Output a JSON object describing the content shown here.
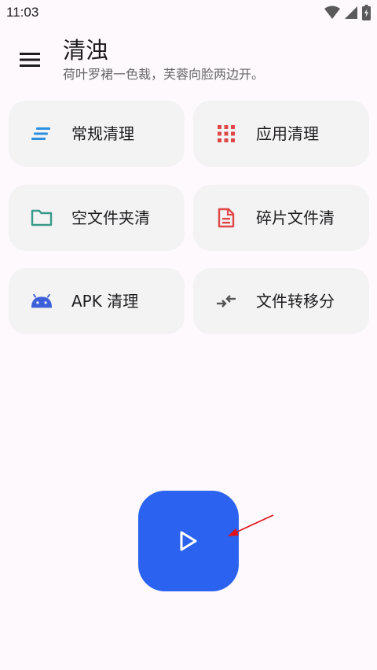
{
  "status_bar": {
    "time": "11:03",
    "icons": [
      "wifi-icon",
      "signal-icon",
      "battery-icon"
    ]
  },
  "header": {
    "menu_icon": "menu-icon",
    "title": "清浊",
    "subtitle": "荷叶罗裙一色裁，芙蓉向脸两边开。"
  },
  "cards": [
    {
      "label": "常规清理",
      "icon": "lines-icon",
      "color": "#2b8fe0"
    },
    {
      "label": "应用清理",
      "icon": "grid-icon",
      "color": "#e04848"
    },
    {
      "label": "空文件夹清",
      "icon": "folder-icon",
      "color": "#3a9a8a"
    },
    {
      "label": "碎片文件清",
      "icon": "document-icon",
      "color": "#e04848"
    },
    {
      "label": "APK 清理",
      "icon": "android-icon",
      "color": "#3d5fd9"
    },
    {
      "label": "文件转移分",
      "icon": "compress-arrows-icon",
      "color": "#555555"
    }
  ],
  "main": {
    "start_button_icon": "play-icon",
    "accent": "#2b63f0",
    "annotation_color": "#e0101a"
  }
}
